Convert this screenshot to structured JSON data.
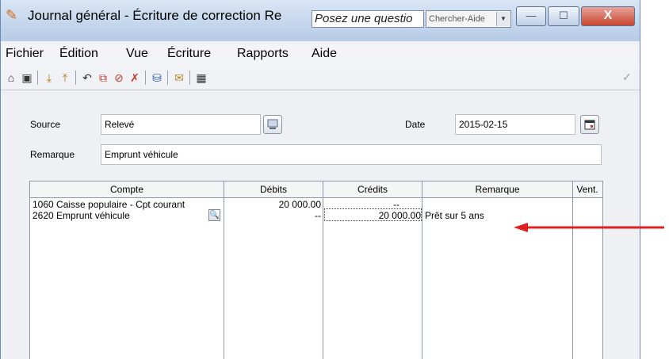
{
  "window": {
    "title": "Journal général - Écriture de correction Re",
    "help_placeholder": "Posez une questio",
    "help_combo": "Chercher-Aide",
    "minimize_symbol": "—",
    "maximize_symbol": "☐",
    "close_symbol": "X"
  },
  "menu": [
    {
      "label": "Fichier"
    },
    {
      "label": "Édition"
    },
    {
      "label": "Vue"
    },
    {
      "label": "Écriture"
    },
    {
      "label": "Rapports"
    },
    {
      "label": "Aide"
    }
  ],
  "toolbar": {
    "icons": [
      "home-icon",
      "window-icon",
      "save-icon",
      "open-icon",
      "undo-icon",
      "copy-entry-icon",
      "delete-entry-icon",
      "clear-icon",
      "post-icon",
      "message-icon",
      "calculator-icon"
    ],
    "check_symbol": "✓"
  },
  "form": {
    "source_label": "Source",
    "source_value": "Relevé",
    "date_label": "Date",
    "date_value": "2015-02-15",
    "remark_label": "Remarque",
    "remark_value": "Emprunt véhicule"
  },
  "table": {
    "headers": [
      "Compte",
      "Débits",
      "Crédits",
      "Remarque",
      "Vent."
    ],
    "rows": [
      {
        "account": "1060 Caisse populaire - Cpt courant",
        "debit": "20 000.00",
        "credit": "--",
        "remark": ""
      },
      {
        "account": "2620 Emprunt véhicule",
        "debit": "--",
        "credit": "20 000.00",
        "remark": "Prêt sur 5 ans"
      }
    ]
  },
  "annotation": {
    "arrow_color": "#e02020"
  }
}
